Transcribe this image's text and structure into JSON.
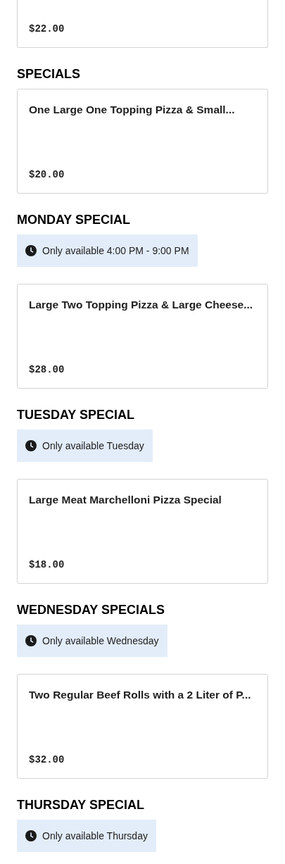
{
  "top_card": {
    "price": "$22.00"
  },
  "sections": [
    {
      "title": "SPECIALS",
      "items": [
        {
          "name": "One Large One Topping Pizza & Small...",
          "price": "$20.00"
        }
      ]
    },
    {
      "title": "MONDAY SPECIAL",
      "availability": "Only available 4:00 PM - 9:00 PM",
      "items": [
        {
          "name": "Large Two Topping Pizza & Large Cheese...",
          "price": "$28.00"
        }
      ]
    },
    {
      "title": "TUESDAY SPECIAL",
      "availability": "Only available Tuesday",
      "items": [
        {
          "name": "Large Meat Marchelloni Pizza Special",
          "price": "$18.00"
        }
      ]
    },
    {
      "title": "WEDNESDAY SPECIALS",
      "availability": "Only available Wednesday",
      "items": [
        {
          "name": "Two Regular Beef Rolls with a 2 Liter of P...",
          "price": "$32.00"
        }
      ]
    },
    {
      "title": "THURSDAY SPECIAL",
      "availability": "Only available Thursday"
    }
  ]
}
